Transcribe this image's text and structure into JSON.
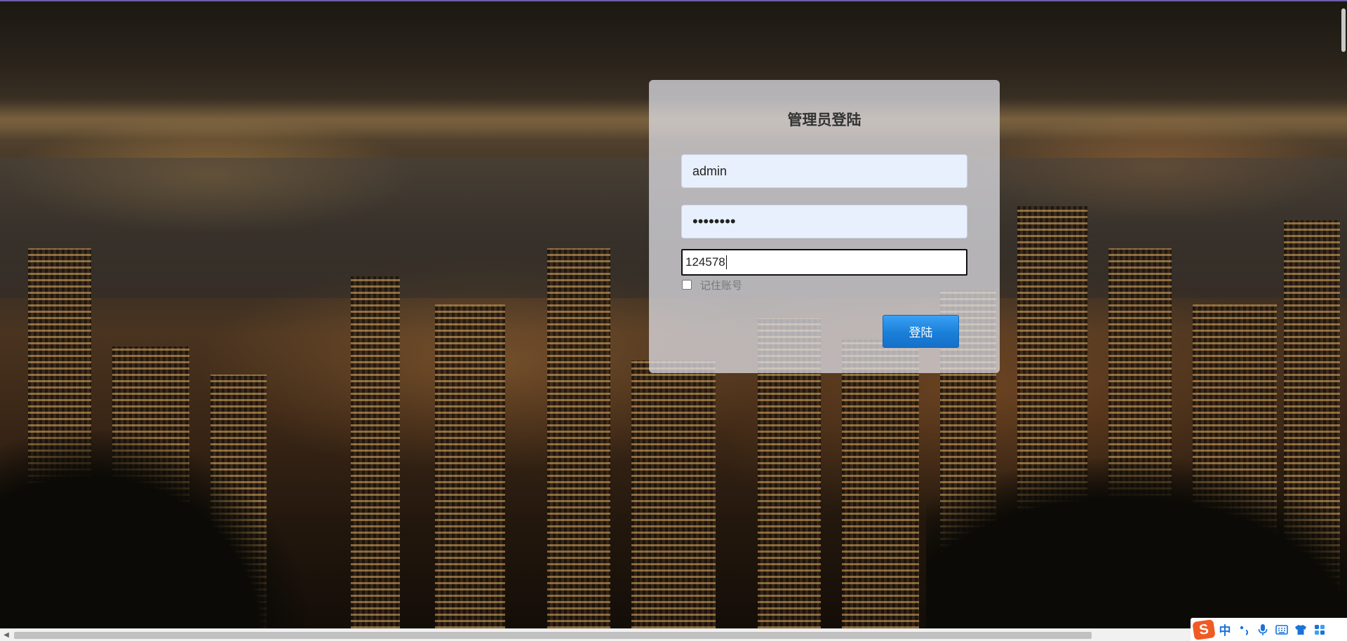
{
  "login": {
    "title": "管理员登陆",
    "username_value": "admin",
    "password_mask": "••••••••",
    "code_value": "124578",
    "remember_label": "记住账号",
    "login_button": "登陆"
  },
  "ime_toolbar": {
    "logo": "S",
    "lang_label": "中",
    "icons": [
      "punctuation-icon",
      "microphone-icon",
      "keyboard-icon",
      "skin-icon",
      "toolbox-icon"
    ]
  },
  "colors": {
    "button_blue": "#1a7fd9",
    "panel_bg": "rgba(225,225,232,0.74)",
    "ime_accent": "#1a73d9",
    "ime_logo": "#f05a24"
  }
}
